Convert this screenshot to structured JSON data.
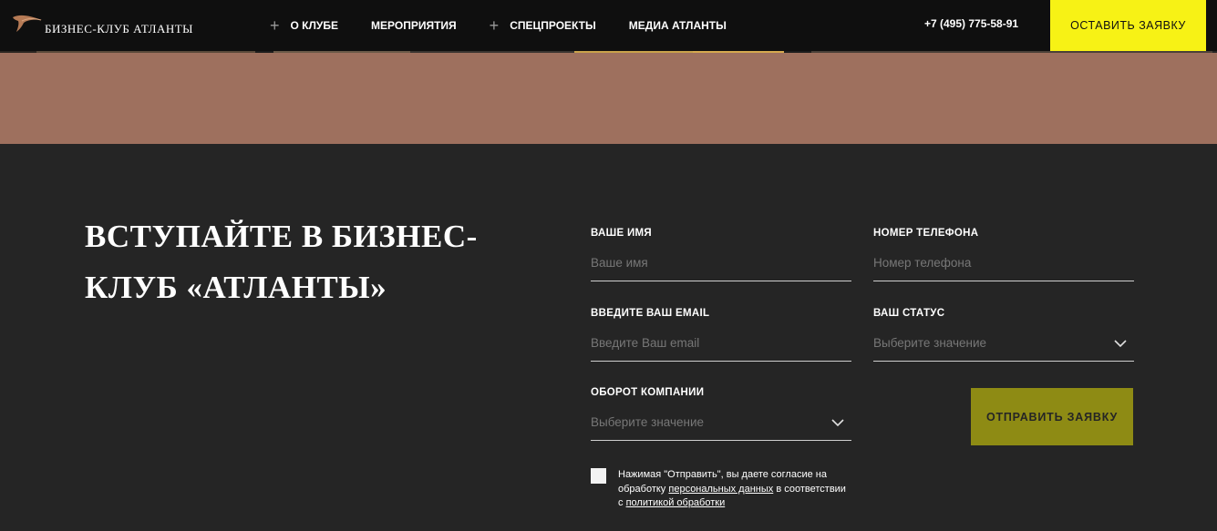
{
  "header": {
    "logo_text": "БИЗНЕС-КЛУБ АТЛАНТЫ",
    "nav": [
      {
        "label": "О КЛУБЕ",
        "has_plus": true
      },
      {
        "label": "МЕРОПРИЯТИЯ",
        "has_plus": false
      },
      {
        "label": "СПЕЦПРОЕКТЫ",
        "has_plus": true
      },
      {
        "label": "МЕДИА АТЛАНТЫ",
        "has_plus": false
      }
    ],
    "phone": "+7 (495) 775-58-91",
    "cta_label": "ОСТАВИТЬ ЗАЯВКУ"
  },
  "colors": {
    "topbar": "#0f0f0f",
    "cta": "#f7f215",
    "banner": "#9e705e",
    "section_bg": "#252525",
    "submit": "#8e8b14"
  },
  "section": {
    "heading": "ВСТУПАЙТЕ В БИЗНЕС-КЛУБ «АТЛАНТЫ»"
  },
  "form": {
    "name": {
      "label": "ВАШЕ ИМЯ",
      "placeholder": "Ваше имя"
    },
    "phone": {
      "label": "НОМЕР ТЕЛЕФОНА",
      "placeholder": "Номер телефона"
    },
    "email": {
      "label": "ВВЕДИТЕ ВАШ EMAIL",
      "placeholder": "Введите Ваш email"
    },
    "status": {
      "label": "ВАШ СТАТУС",
      "value": "Выберите значение"
    },
    "turnover": {
      "label": "ОБОРОТ КОМПАНИИ",
      "value": "Выберите значение"
    },
    "submit_label": "ОТПРАВИТЬ ЗАЯВКУ",
    "consent": {
      "text_1": "Нажимая \"Отправить\", вы даете согласие на обработку ",
      "link_1": "персональных данных",
      "text_2": " в соответствии с ",
      "link_2": "политикой обработки"
    }
  }
}
